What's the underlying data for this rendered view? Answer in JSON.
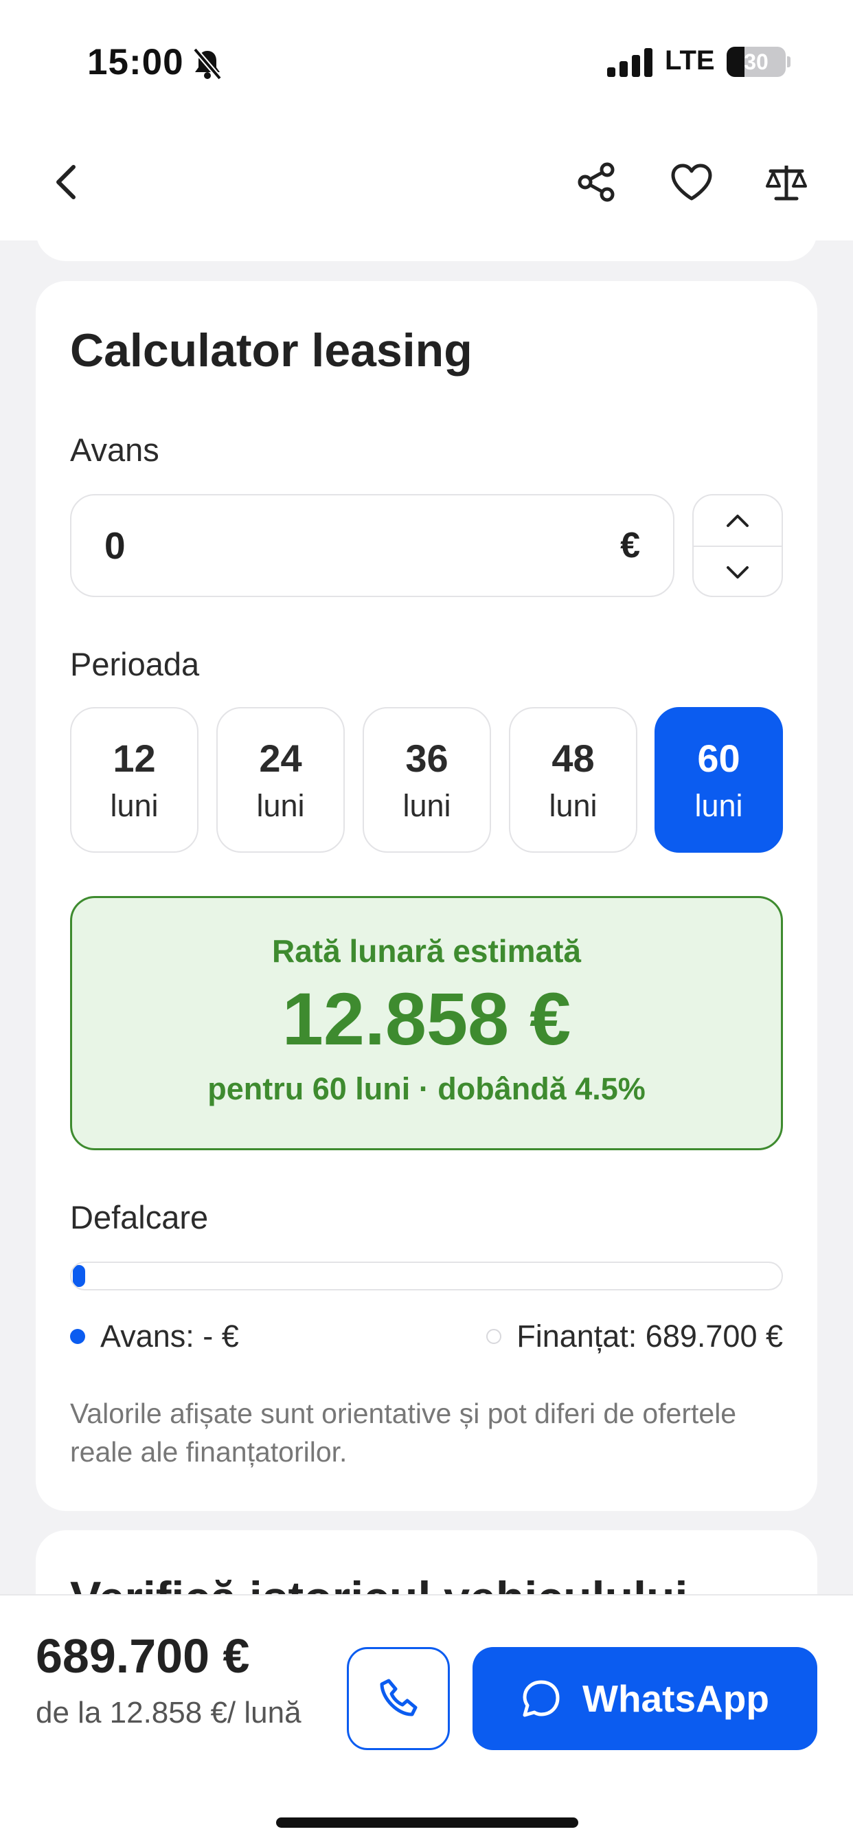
{
  "status_bar": {
    "time": "15:00",
    "network": "LTE",
    "battery": "30",
    "battery_level": 0.3
  },
  "nav": {
    "icons": [
      "back-icon",
      "share-icon",
      "heart-icon",
      "compare-scale-icon"
    ]
  },
  "calculator": {
    "title": "Calculator leasing",
    "avans_label": "Avans",
    "avans_value": "0",
    "currency": "€",
    "period_label": "Perioada",
    "periods": [
      {
        "num": "12",
        "unit": "luni",
        "selected": false
      },
      {
        "num": "24",
        "unit": "luni",
        "selected": false
      },
      {
        "num": "36",
        "unit": "luni",
        "selected": false
      },
      {
        "num": "48",
        "unit": "luni",
        "selected": false
      },
      {
        "num": "60",
        "unit": "luni",
        "selected": true
      }
    ],
    "result": {
      "label": "Rată lunară estimată",
      "value": "12.858 €",
      "subtitle": "pentru 60 luni · dobândă 4.5%"
    },
    "breakdown": {
      "label": "Defalcare",
      "avans_share": 0,
      "legend_avans": "Avans: - €",
      "legend_finantat": "Finanțat: 689.700 €"
    },
    "note": "Valorile afișate sunt orientative și pot diferi de ofertele reale ale finanțatorilor."
  },
  "next_section": {
    "title": "Verifică istoricul vehiculului"
  },
  "bottom_bar": {
    "price": "689.700 €",
    "per_month": "de la 12.858 €/ lună",
    "whatsapp_label": "WhatsApp"
  },
  "colors": {
    "accent": "#0b5cf0",
    "success": "#3e8b2f",
    "success_bg": "#e8f5e6"
  }
}
